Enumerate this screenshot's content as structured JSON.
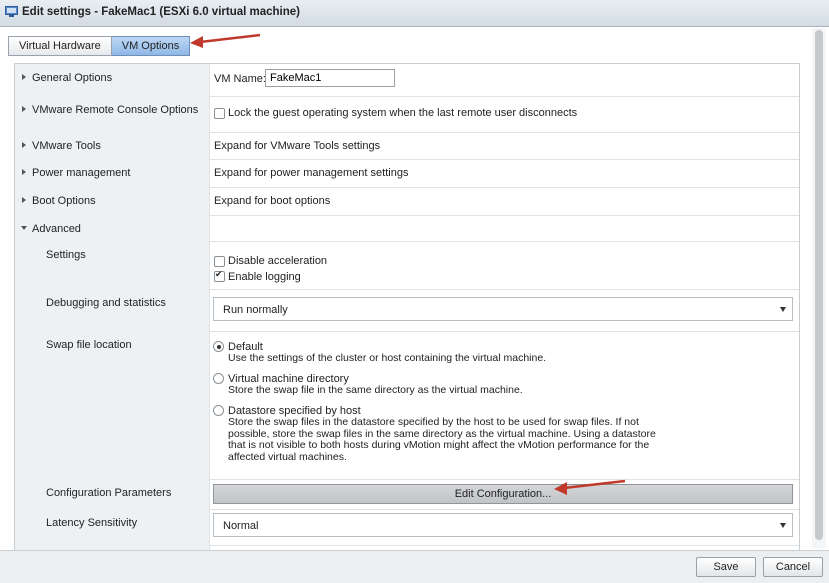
{
  "window": {
    "title": "Edit settings - FakeMac1 (ESXi 6.0 virtual machine)"
  },
  "tabs": [
    {
      "label": "Virtual Hardware",
      "active": false
    },
    {
      "label": "VM Options",
      "active": true
    }
  ],
  "general": {
    "label": "General Options",
    "vm_name_label": "VM Name:",
    "vm_name_value": "FakeMac1"
  },
  "remote_console": {
    "label": "VMware Remote Console Options",
    "lock_label": "Lock the guest operating system when the last remote user disconnects",
    "lock_checked": false
  },
  "tools": {
    "label": "VMware Tools",
    "value": "Expand for VMware Tools settings"
  },
  "power": {
    "label": "Power management",
    "value": "Expand for power management settings"
  },
  "boot": {
    "label": "Boot Options",
    "value": "Expand for boot options"
  },
  "advanced": {
    "label": "Advanced",
    "settings": {
      "label": "Settings",
      "disable_accel_label": "Disable acceleration",
      "disable_accel_checked": false,
      "enable_logging_label": "Enable logging",
      "enable_logging_checked": true
    },
    "debugging": {
      "label": "Debugging and statistics",
      "selected": "Run normally"
    },
    "swap": {
      "label": "Swap file location",
      "options": [
        {
          "title": "Default",
          "desc": [
            "Use the settings of the cluster or host containing the virtual machine."
          ],
          "selected": true
        },
        {
          "title": "Virtual machine directory",
          "desc": [
            "Store the swap file in the same directory as the virtual machine."
          ],
          "selected": false
        },
        {
          "title": "Datastore specified by host",
          "desc": [
            "Store the swap files in the datastore specified by the host to be used for swap files. If not",
            "possible, store the swap files in the same directory as the virtual machine. Using a datastore",
            "that is not visible to both hosts during vMotion might affect the vMotion performance for the",
            "affected virtual machines."
          ],
          "selected": false
        }
      ]
    },
    "config_params": {
      "label": "Configuration Parameters",
      "button": "Edit Configuration..."
    },
    "latency": {
      "label": "Latency Sensitivity",
      "selected": "Normal"
    }
  },
  "footer": {
    "save": "Save",
    "cancel": "Cancel"
  },
  "colors": {
    "annotation_arrow": "#c0392b",
    "active_tab": "#9cc2ec",
    "label_column": "#eef1f4"
  }
}
